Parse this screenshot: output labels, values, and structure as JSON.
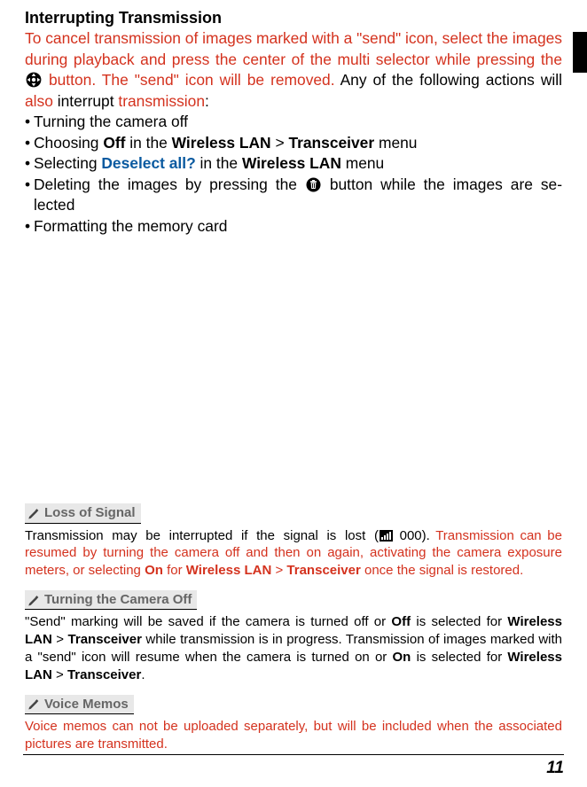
{
  "heading": "Interrupting Transmission",
  "intro": {
    "p1a": "To cancel transmission of images marked with a \"send\" icon, select the im­ages during playback and press the center of the multi selector while pressing the ",
    "p1b": " button.  The \"send\" icon will be removed.",
    "p1c": "  Any of the following actions will ",
    "also": "also",
    "p1d": " interrupt ",
    "trans": "transmission",
    "p1e": ":"
  },
  "bullets": {
    "b1": "Turning the camera off",
    "b2a": "Choosing ",
    "b2b": "Off",
    "b2c": " in the ",
    "b2d": "Wireless LAN",
    "b2e": " > ",
    "b2f": "Transceiver",
    "b2g": " menu",
    "b3a": "Selecting ",
    "b3b": "Deselect all?",
    "b3c": " in the ",
    "b3d": "Wireless LAN",
    "b3e": " menu",
    "b4a": "Deleting the images by pressing the ",
    "b4b": " button while the images are se­lected",
    "b5": "Formatting the memory card"
  },
  "notes": {
    "loss": {
      "title": "Loss of Signal",
      "p1a": "Transmission may be interrupted if the signal is lost (",
      "p1b": " 000).  ",
      "p1c": "Transmission can be resumed by turning the camera off and then on again, activating the camera exposure meters, or selecting ",
      "on": "On",
      "p1d": " for ",
      "wlan": "Wireless LAN",
      "gt": " > ",
      "trx": "Transceiver",
      "p1e": " once the signal is restored."
    },
    "turning": {
      "title": "Turning the Camera Off",
      "body_a": "\"Send\" marking will be saved if the camera is turned off or ",
      "off": "Off",
      "body_b": " is selected for ",
      "wlan": "Wireless LAN",
      "gt": " > ",
      "trx": "Transceiver",
      "body_c": " while transmission is in progress.  Transmission of images marked with a \"send\" icon will resume when the camera is turned on or ",
      "on": "On",
      "body_d": " is selected for ",
      "wlan2": "Wireless LAN",
      "gt2": " > ",
      "trx2": "Transceiver",
      "body_e": "."
    },
    "voice": {
      "title": "Voice Memos",
      "body": "Voice memos can not be uploaded separately, but will be included when the associated pictures are transmitted."
    }
  },
  "page_number": "11"
}
